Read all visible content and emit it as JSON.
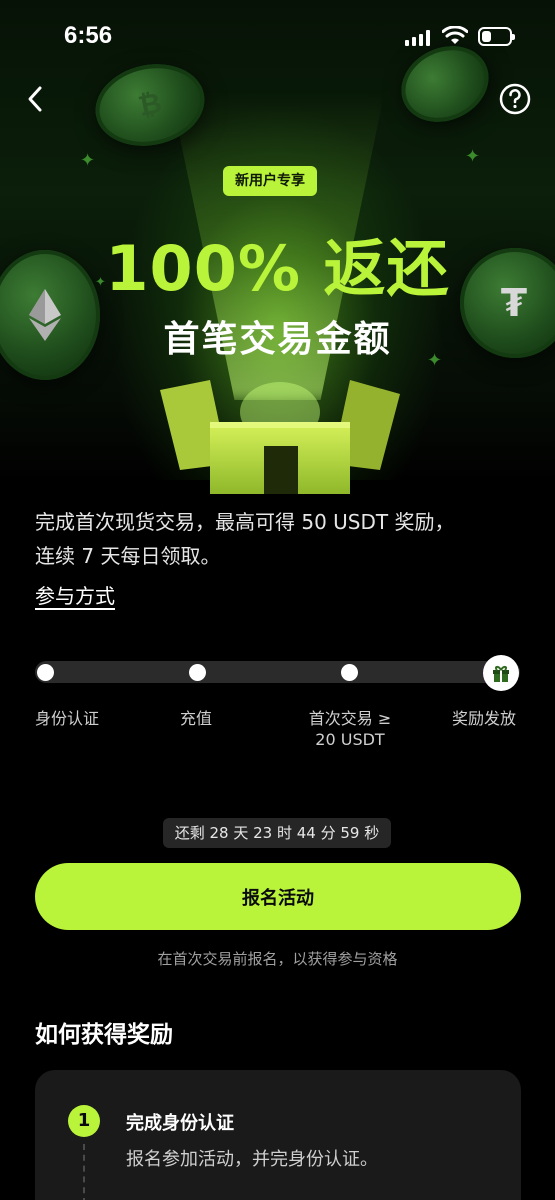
{
  "status_bar": {
    "time": "6:56"
  },
  "hero": {
    "badge": "新用户专享",
    "title": "100% 返还",
    "subtitle": "首笔交易金额"
  },
  "description": {
    "line1": "完成首次现货交易，最高可得 50 USDT 奖励，",
    "line2": "连续 7 天每日领取。"
  },
  "participate_link": "参与方式",
  "progress": {
    "steps": [
      {
        "label": "身份认证"
      },
      {
        "label": "充值"
      },
      {
        "label_line1": "首次交易 ≥",
        "label_line2": "20 USDT"
      },
      {
        "label": "奖励发放"
      }
    ],
    "completed": 0
  },
  "countdown": "还剩 28 天 23 时 44 分 59 秒",
  "register_button": "报名活动",
  "register_note": "在首次交易前报名，以获得参与资格",
  "how_to": {
    "title": "如何获得奖励",
    "steps": [
      {
        "number": "1",
        "title": "完成身份认证",
        "desc": "报名参加活动，并完身份认证。"
      }
    ]
  },
  "colors": {
    "accent": "#b9f33a",
    "background": "#000000",
    "card": "#1a1a1a"
  },
  "icons": [
    "back-arrow-icon",
    "help-icon",
    "gift-icon",
    "signal-icon",
    "wifi-icon",
    "battery-icon"
  ]
}
